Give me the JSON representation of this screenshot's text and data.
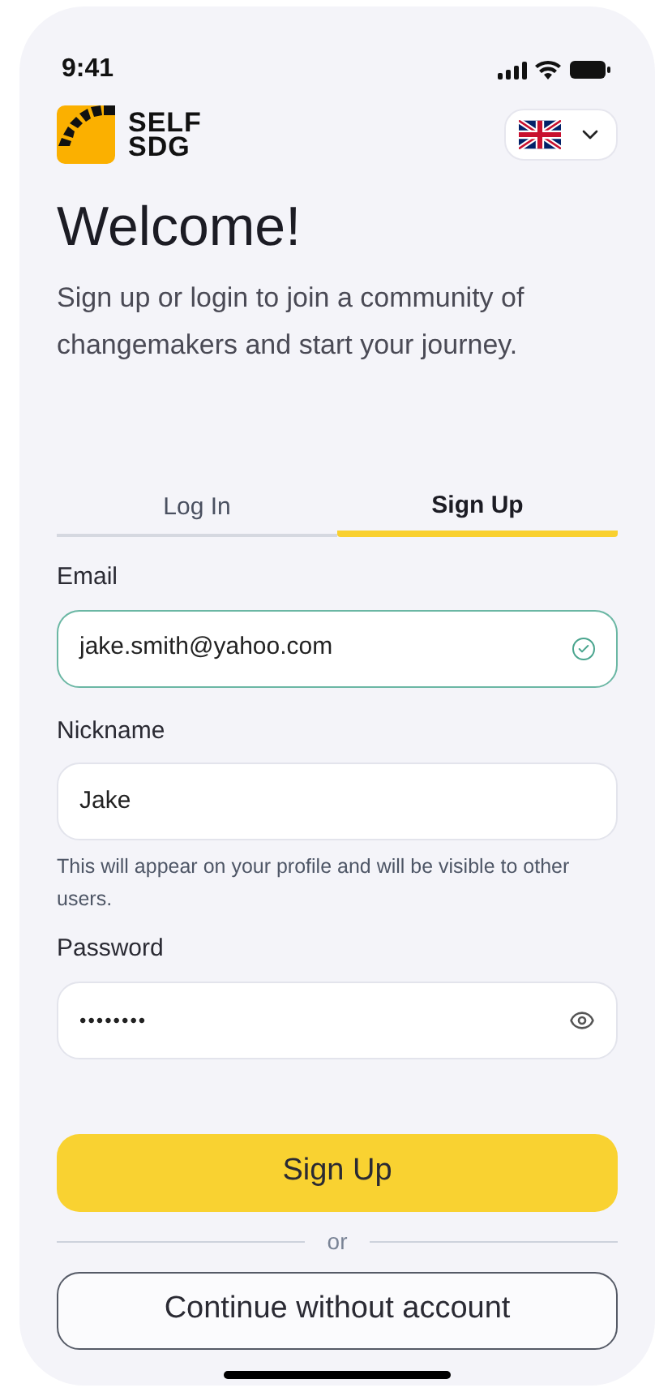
{
  "status_bar": {
    "time": "9:41"
  },
  "logo": {
    "lines": [
      "SELF",
      "SDG"
    ]
  },
  "title": "Welcome!",
  "subtitle": "Sign up or login to join a community of changemakers and start your journey.",
  "tabs": [
    {
      "label": "Log In",
      "selected": false
    },
    {
      "label": "Sign Up",
      "selected": true
    }
  ],
  "fields": [
    {
      "label": "Email",
      "value": "jake.smith@yahoo.com",
      "kind": "text",
      "valid": true
    },
    {
      "label": "Nickname",
      "value": "Jake",
      "kind": "text",
      "valid": false,
      "help": "This will appear on your profile and will be visible to other users."
    },
    {
      "label": "Password",
      "value": "••••••••",
      "kind": "password",
      "valid": false
    }
  ],
  "primary_button": "Sign Up",
  "divider": "or",
  "secondary_button": "Continue without account"
}
